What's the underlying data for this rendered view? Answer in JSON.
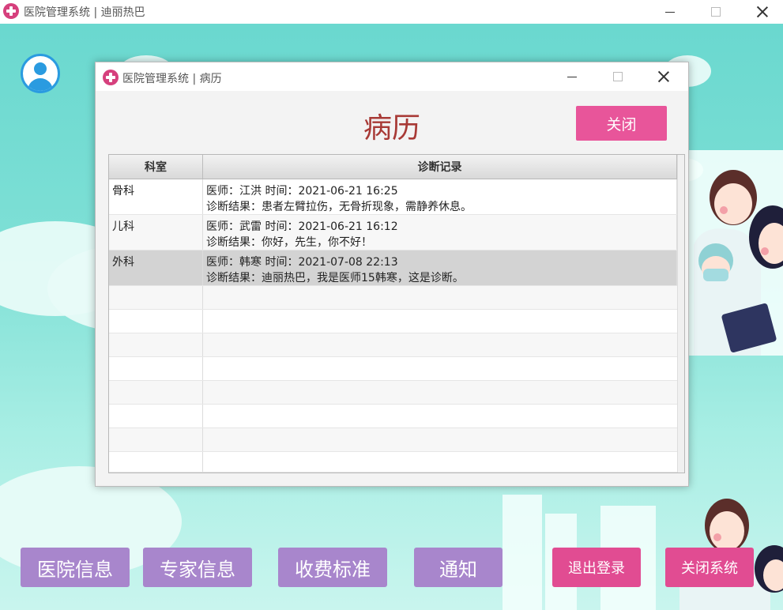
{
  "outer_window": {
    "title": "医院管理系统 | 迪丽热巴"
  },
  "bottom_buttons": {
    "hospital_info": "医院信息",
    "expert_info": "专家信息",
    "fee_standard": "收费标准",
    "notice": "通知",
    "logout": "退出登录",
    "close_system": "关闭系统"
  },
  "dialog": {
    "title": "医院管理系统 | 病历",
    "heading": "病历",
    "close_button": "关闭",
    "table": {
      "columns": [
        "科室",
        "诊断记录"
      ],
      "rows": [
        {
          "department": "骨科",
          "line1": "医师：江洪 时间：2021-06-21 16:25",
          "line2": "诊断结果：患者左臂拉伤，无骨折现象，需静养休息。"
        },
        {
          "department": "儿科",
          "line1": "医师：武雷 时间：2021-06-21 16:12",
          "line2": "诊断结果：你好，先生，你不好！"
        },
        {
          "department": "外科",
          "line1": "医师：韩寒 时间：2021-07-08 22:13",
          "line2": "诊断结果：迪丽热巴，我是医师15韩寒，这是诊断。"
        }
      ]
    }
  },
  "colors": {
    "accent_pink": "#e14c92",
    "button_purple": "#a886cc",
    "heading_red": "#a83a36",
    "background_teal": "#7fe0d6"
  }
}
